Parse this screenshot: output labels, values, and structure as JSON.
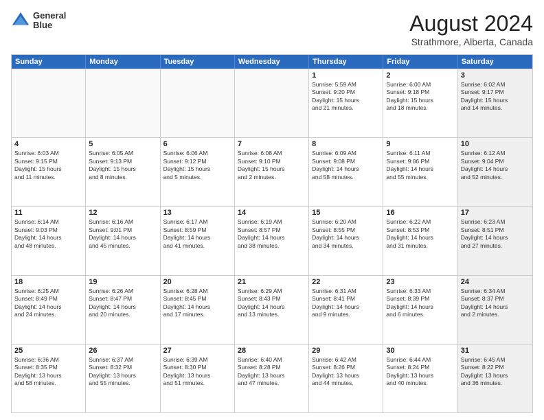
{
  "header": {
    "logo_line1": "General",
    "logo_line2": "Blue",
    "main_title": "August 2024",
    "subtitle": "Strathmore, Alberta, Canada"
  },
  "calendar": {
    "days_of_week": [
      "Sunday",
      "Monday",
      "Tuesday",
      "Wednesday",
      "Thursday",
      "Friday",
      "Saturday"
    ],
    "rows": [
      [
        {
          "day": "",
          "info": "",
          "empty": true
        },
        {
          "day": "",
          "info": "",
          "empty": true
        },
        {
          "day": "",
          "info": "",
          "empty": true
        },
        {
          "day": "",
          "info": "",
          "empty": true
        },
        {
          "day": "1",
          "info": "Sunrise: 5:59 AM\nSunset: 9:20 PM\nDaylight: 15 hours\nand 21 minutes."
        },
        {
          "day": "2",
          "info": "Sunrise: 6:00 AM\nSunset: 9:18 PM\nDaylight: 15 hours\nand 18 minutes."
        },
        {
          "day": "3",
          "info": "Sunrise: 6:02 AM\nSunset: 9:17 PM\nDaylight: 15 hours\nand 14 minutes.",
          "shaded": true
        }
      ],
      [
        {
          "day": "4",
          "info": "Sunrise: 6:03 AM\nSunset: 9:15 PM\nDaylight: 15 hours\nand 11 minutes."
        },
        {
          "day": "5",
          "info": "Sunrise: 6:05 AM\nSunset: 9:13 PM\nDaylight: 15 hours\nand 8 minutes."
        },
        {
          "day": "6",
          "info": "Sunrise: 6:06 AM\nSunset: 9:12 PM\nDaylight: 15 hours\nand 5 minutes."
        },
        {
          "day": "7",
          "info": "Sunrise: 6:08 AM\nSunset: 9:10 PM\nDaylight: 15 hours\nand 2 minutes."
        },
        {
          "day": "8",
          "info": "Sunrise: 6:09 AM\nSunset: 9:08 PM\nDaylight: 14 hours\nand 58 minutes."
        },
        {
          "day": "9",
          "info": "Sunrise: 6:11 AM\nSunset: 9:06 PM\nDaylight: 14 hours\nand 55 minutes."
        },
        {
          "day": "10",
          "info": "Sunrise: 6:12 AM\nSunset: 9:04 PM\nDaylight: 14 hours\nand 52 minutes.",
          "shaded": true
        }
      ],
      [
        {
          "day": "11",
          "info": "Sunrise: 6:14 AM\nSunset: 9:03 PM\nDaylight: 14 hours\nand 48 minutes."
        },
        {
          "day": "12",
          "info": "Sunrise: 6:16 AM\nSunset: 9:01 PM\nDaylight: 14 hours\nand 45 minutes."
        },
        {
          "day": "13",
          "info": "Sunrise: 6:17 AM\nSunset: 8:59 PM\nDaylight: 14 hours\nand 41 minutes."
        },
        {
          "day": "14",
          "info": "Sunrise: 6:19 AM\nSunset: 8:57 PM\nDaylight: 14 hours\nand 38 minutes."
        },
        {
          "day": "15",
          "info": "Sunrise: 6:20 AM\nSunset: 8:55 PM\nDaylight: 14 hours\nand 34 minutes."
        },
        {
          "day": "16",
          "info": "Sunrise: 6:22 AM\nSunset: 8:53 PM\nDaylight: 14 hours\nand 31 minutes."
        },
        {
          "day": "17",
          "info": "Sunrise: 6:23 AM\nSunset: 8:51 PM\nDaylight: 14 hours\nand 27 minutes.",
          "shaded": true
        }
      ],
      [
        {
          "day": "18",
          "info": "Sunrise: 6:25 AM\nSunset: 8:49 PM\nDaylight: 14 hours\nand 24 minutes."
        },
        {
          "day": "19",
          "info": "Sunrise: 6:26 AM\nSunset: 8:47 PM\nDaylight: 14 hours\nand 20 minutes."
        },
        {
          "day": "20",
          "info": "Sunrise: 6:28 AM\nSunset: 8:45 PM\nDaylight: 14 hours\nand 17 minutes."
        },
        {
          "day": "21",
          "info": "Sunrise: 6:29 AM\nSunset: 8:43 PM\nDaylight: 14 hours\nand 13 minutes."
        },
        {
          "day": "22",
          "info": "Sunrise: 6:31 AM\nSunset: 8:41 PM\nDaylight: 14 hours\nand 9 minutes."
        },
        {
          "day": "23",
          "info": "Sunrise: 6:33 AM\nSunset: 8:39 PM\nDaylight: 14 hours\nand 6 minutes."
        },
        {
          "day": "24",
          "info": "Sunrise: 6:34 AM\nSunset: 8:37 PM\nDaylight: 14 hours\nand 2 minutes.",
          "shaded": true
        }
      ],
      [
        {
          "day": "25",
          "info": "Sunrise: 6:36 AM\nSunset: 8:35 PM\nDaylight: 13 hours\nand 58 minutes."
        },
        {
          "day": "26",
          "info": "Sunrise: 6:37 AM\nSunset: 8:32 PM\nDaylight: 13 hours\nand 55 minutes."
        },
        {
          "day": "27",
          "info": "Sunrise: 6:39 AM\nSunset: 8:30 PM\nDaylight: 13 hours\nand 51 minutes."
        },
        {
          "day": "28",
          "info": "Sunrise: 6:40 AM\nSunset: 8:28 PM\nDaylight: 13 hours\nand 47 minutes."
        },
        {
          "day": "29",
          "info": "Sunrise: 6:42 AM\nSunset: 8:26 PM\nDaylight: 13 hours\nand 44 minutes."
        },
        {
          "day": "30",
          "info": "Sunrise: 6:44 AM\nSunset: 8:24 PM\nDaylight: 13 hours\nand 40 minutes."
        },
        {
          "day": "31",
          "info": "Sunrise: 6:45 AM\nSunset: 8:22 PM\nDaylight: 13 hours\nand 36 minutes.",
          "shaded": true
        }
      ]
    ]
  }
}
